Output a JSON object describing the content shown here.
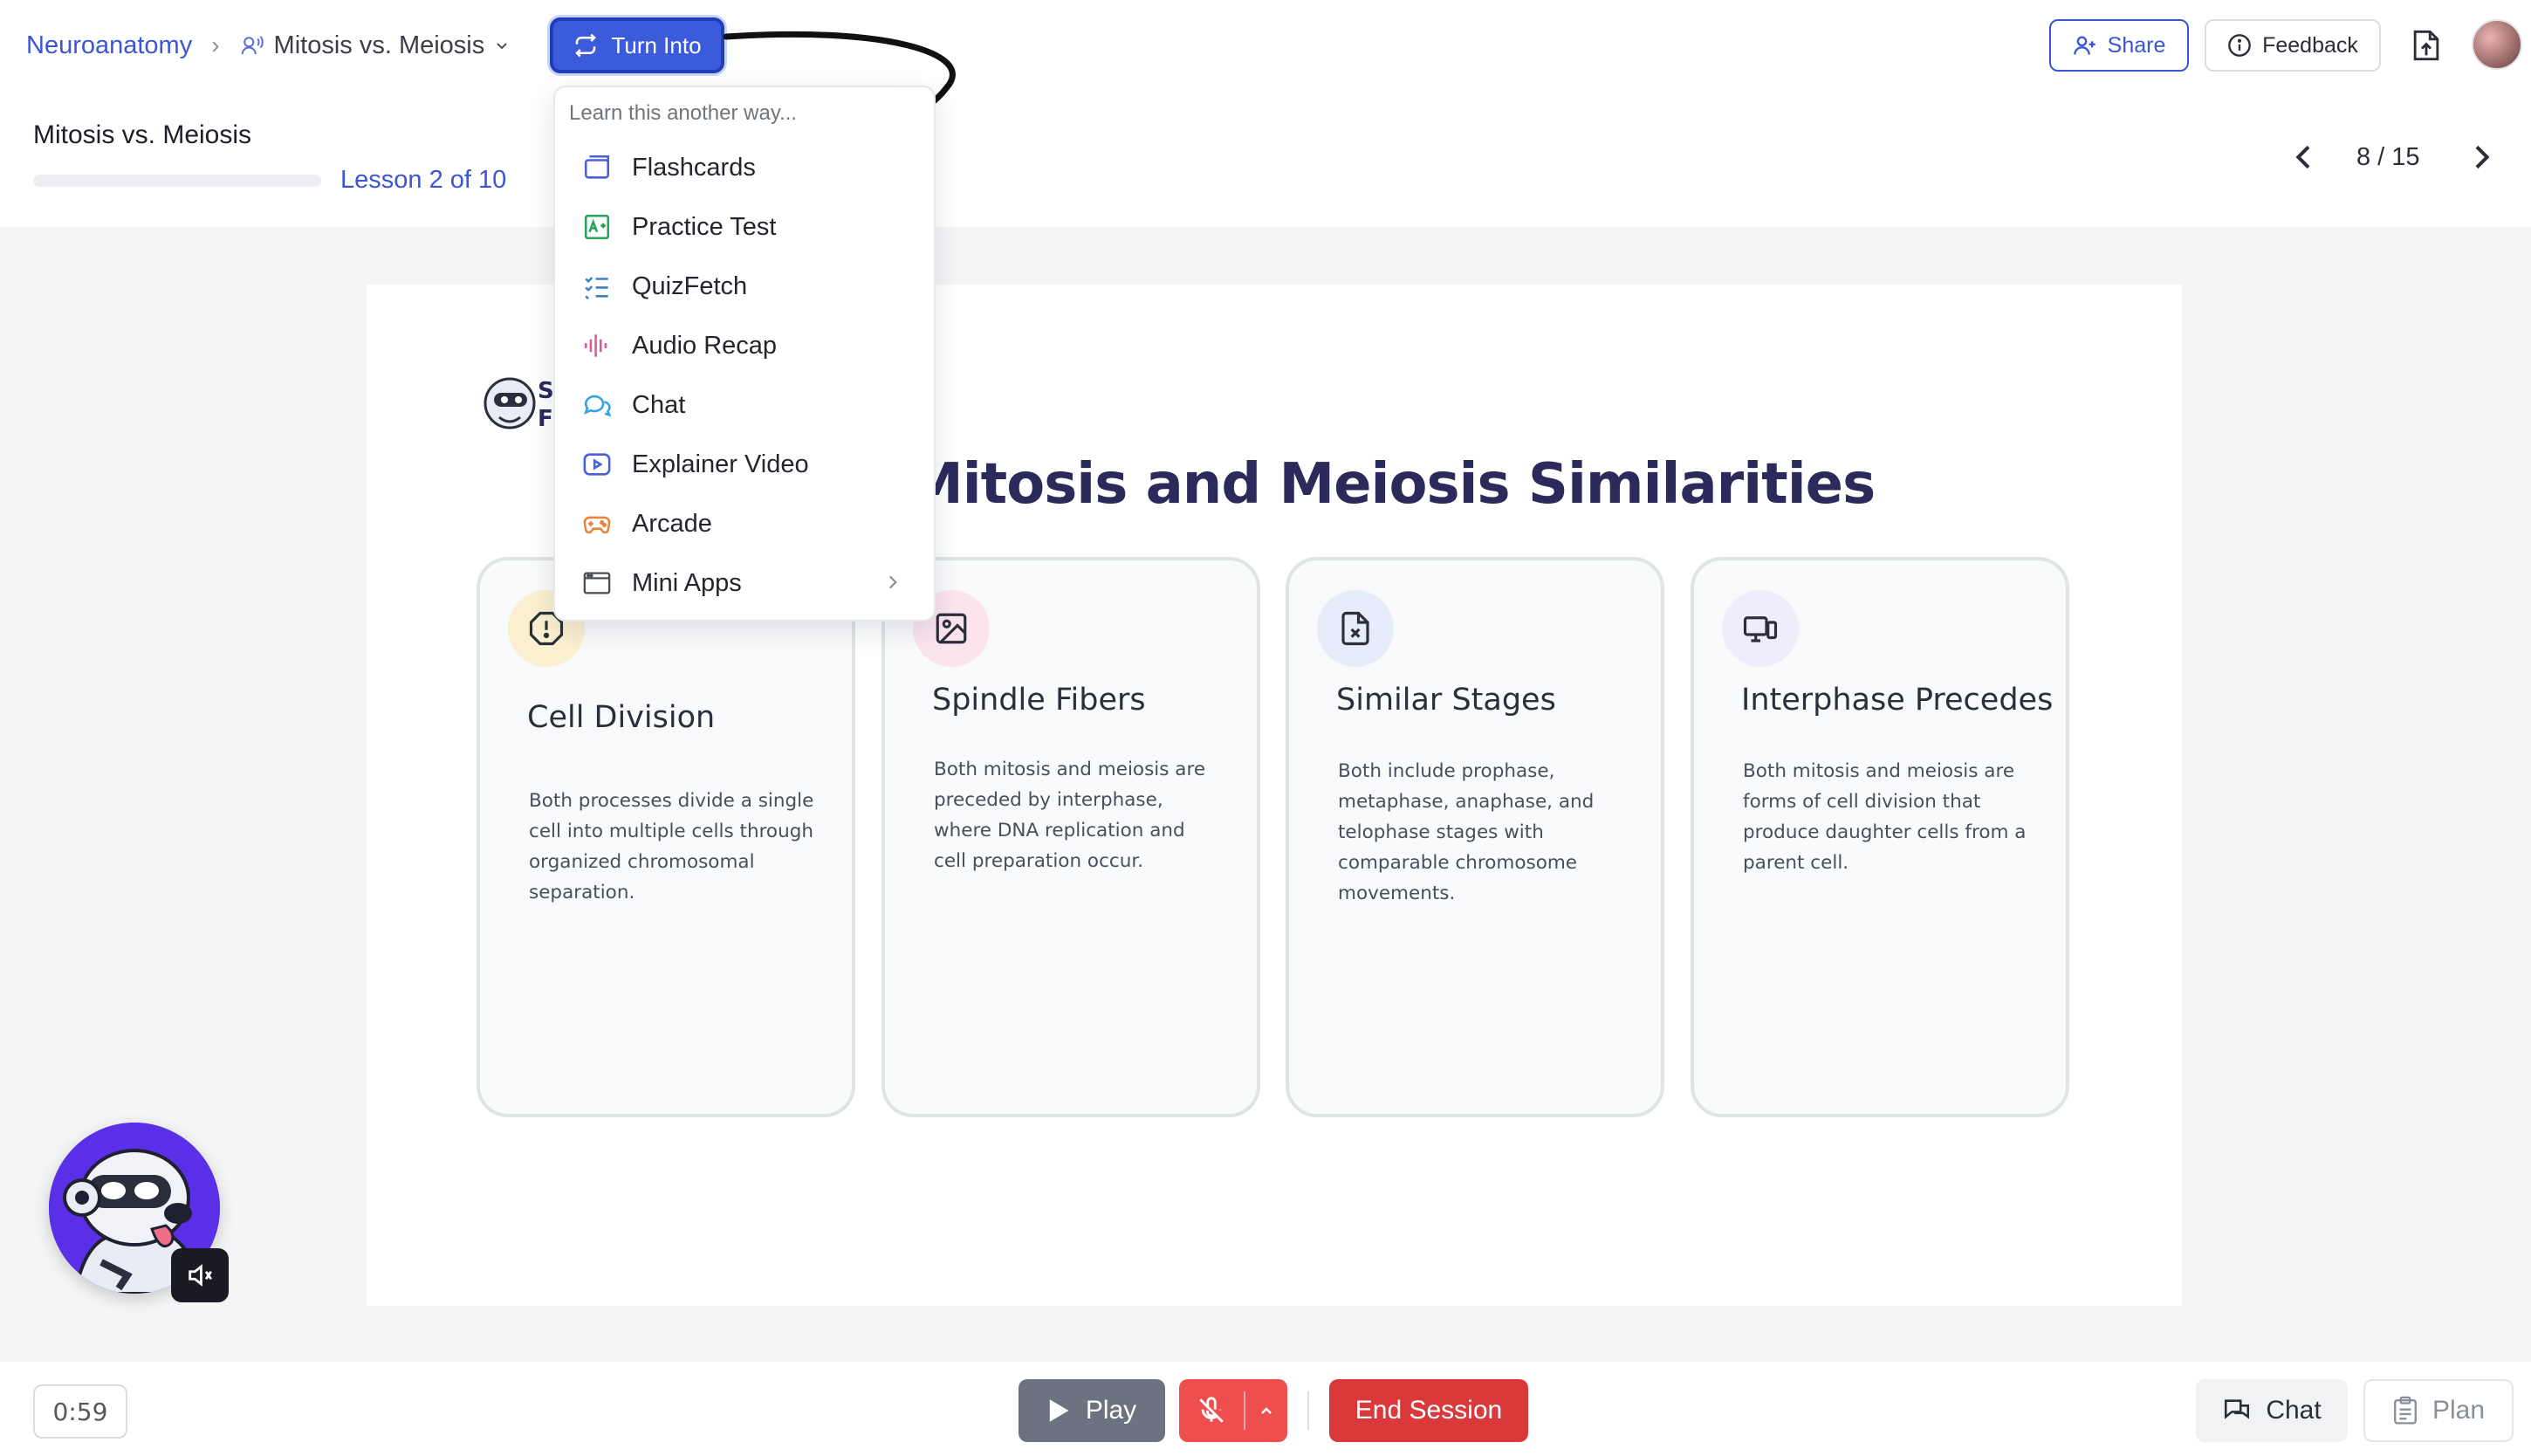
{
  "header": {
    "breadcrumb": {
      "course": "Neuroanatomy",
      "current": "Mitosis vs. Meiosis"
    },
    "turn_into_label": "Turn Into",
    "share_label": "Share",
    "feedback_label": "Feedback",
    "lesson_title": "Mitosis vs. Meiosis",
    "lesson_progress": "Lesson 2 of 10",
    "progress_fraction": 0.0,
    "page_indicator": "8 / 15"
  },
  "menu": {
    "hint": "Learn this another way...",
    "items": [
      {
        "label": "Flashcards",
        "icon": "flashcards-icon",
        "color": "#4a5fd9"
      },
      {
        "label": "Practice Test",
        "icon": "practice-test-icon",
        "color": "#27a35a"
      },
      {
        "label": "QuizFetch",
        "icon": "quiz-list-icon",
        "color": "#3b82c4"
      },
      {
        "label": "Audio Recap",
        "icon": "audio-wave-icon",
        "color": "#e0559a"
      },
      {
        "label": "Chat",
        "icon": "chat-bubbles-icon",
        "color": "#2fa3e6"
      },
      {
        "label": "Explainer Video",
        "icon": "video-play-icon",
        "color": "#4a5fd9"
      },
      {
        "label": "Arcade",
        "icon": "gamepad-icon",
        "color": "#e8843c"
      },
      {
        "label": "Mini Apps",
        "icon": "app-window-icon",
        "color": "#4a4d57"
      }
    ]
  },
  "slide": {
    "logo_letters": "S F",
    "title": "Mitosis and Meiosis Similarities",
    "cards": [
      {
        "title": "Cell Division",
        "text": "Both processes divide a single cell into multiple cells through organized chromosomal separation.",
        "icon": "alert-octagon-icon",
        "icon_bg": "#fbf0cf"
      },
      {
        "title": "Spindle Fibers",
        "text": "Both mitosis and meiosis are preceded by interphase, where DNA replication and cell preparation occur.",
        "icon": "image-icon",
        "icon_bg": "#fbe4ee"
      },
      {
        "title": "Similar Stages",
        "text": "Both include prophase, metaphase, anaphase, and telophase stages with comparable chromosome movements.",
        "icon": "file-x-icon",
        "icon_bg": "#e6ecfa"
      },
      {
        "title": "Interphase Precedes",
        "text": "Both mitosis and meiosis are forms of cell division that produce daughter cells from a parent cell.",
        "icon": "devices-icon",
        "icon_bg": "#efedfb"
      }
    ]
  },
  "bottom": {
    "timer": "0:59",
    "play_label": "Play",
    "end_label": "End Session",
    "chat_label": "Chat",
    "plan_label": "Plan"
  }
}
